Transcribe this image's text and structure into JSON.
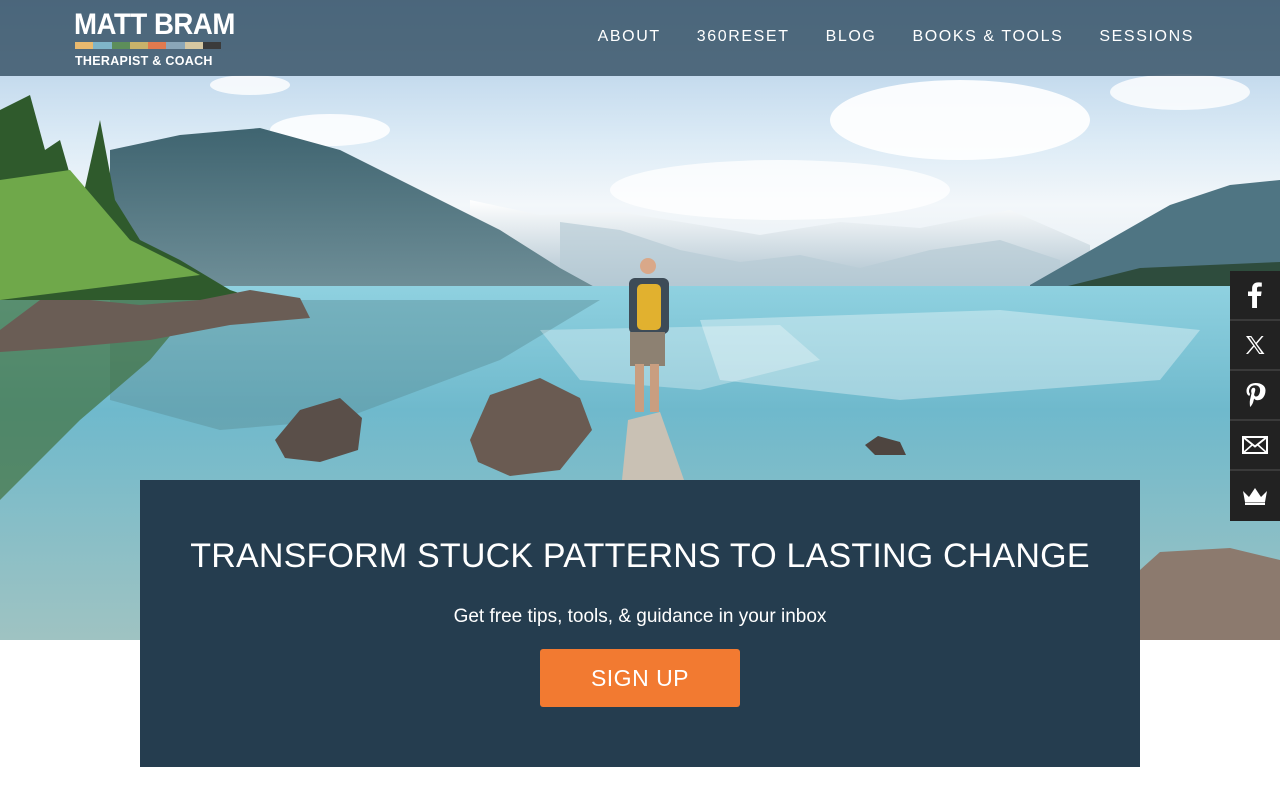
{
  "brand": {
    "name": "MATT BRAM",
    "tagline": "THERAPIST & COACH",
    "stripe_colors": [
      "#e9b96e",
      "#7fb5c9",
      "#5d8e5a",
      "#c9b26a",
      "#e07a4f",
      "#8aa6b8",
      "#d6c7a1",
      "#3b3b3b"
    ]
  },
  "nav": {
    "items": [
      {
        "label": "ABOUT"
      },
      {
        "label": "360RESET"
      },
      {
        "label": "BLOG"
      },
      {
        "label": "BOOKS & TOOLS"
      },
      {
        "label": "SESSIONS"
      }
    ]
  },
  "social": {
    "buttons": [
      {
        "icon": "facebook-icon"
      },
      {
        "icon": "x-icon"
      },
      {
        "icon": "pinterest-icon"
      },
      {
        "icon": "email-icon"
      },
      {
        "icon": "crown-icon"
      }
    ]
  },
  "hero": {
    "image": "person-standing-on-rock-by-mountain-lake"
  },
  "signup": {
    "headline": "TRANSFORM STUCK PATTERNS TO LASTING CHANGE",
    "subtext": "Get free tips, tools, & guidance in your inbox",
    "button_label": "SIGN UP"
  },
  "colors": {
    "header_bg": "#365064",
    "panel_bg": "#253d4f",
    "cta": "#f27a31",
    "social_bg": "#222222"
  }
}
